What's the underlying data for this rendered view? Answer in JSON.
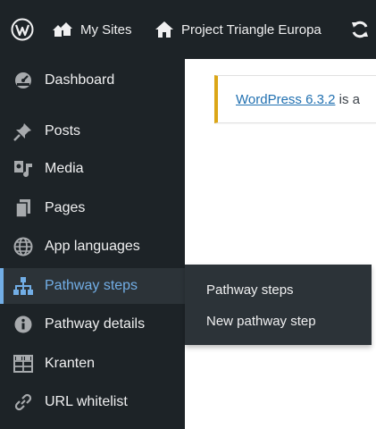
{
  "adminbar": {
    "wp_logo": "wordpress-logo-icon",
    "my_sites": {
      "label": "My Sites",
      "icon": "my-sites-icon"
    },
    "site": {
      "label": "Project Triangle Europa",
      "icon": "home-icon"
    },
    "updates": {
      "icon": "updates-icon"
    }
  },
  "sidebar": {
    "items": [
      {
        "label": "Dashboard",
        "icon": "dashboard-icon"
      },
      {
        "label": "Posts",
        "icon": "pushpin-icon"
      },
      {
        "label": "Media",
        "icon": "media-icon"
      },
      {
        "label": "Pages",
        "icon": "pages-icon"
      },
      {
        "label": "App languages",
        "icon": "globe-icon"
      },
      {
        "label": "Pathway steps",
        "icon": "networking-icon",
        "active": true
      },
      {
        "label": "Pathway details",
        "icon": "info-icon"
      },
      {
        "label": "Kranten",
        "icon": "grid-icon"
      },
      {
        "label": "URL whitelist",
        "icon": "link-icon"
      }
    ]
  },
  "flyout": {
    "items": [
      {
        "label": "Pathway steps"
      },
      {
        "label": "New pathway step"
      }
    ]
  },
  "notice": {
    "link_text": "WordPress 6.3.2",
    "text": " is a"
  },
  "colors": {
    "bar_bg": "#1d2327",
    "active_bg": "#2c3338",
    "accent": "#72aee6",
    "link": "#2271b1",
    "notice_border": "#dba617"
  }
}
